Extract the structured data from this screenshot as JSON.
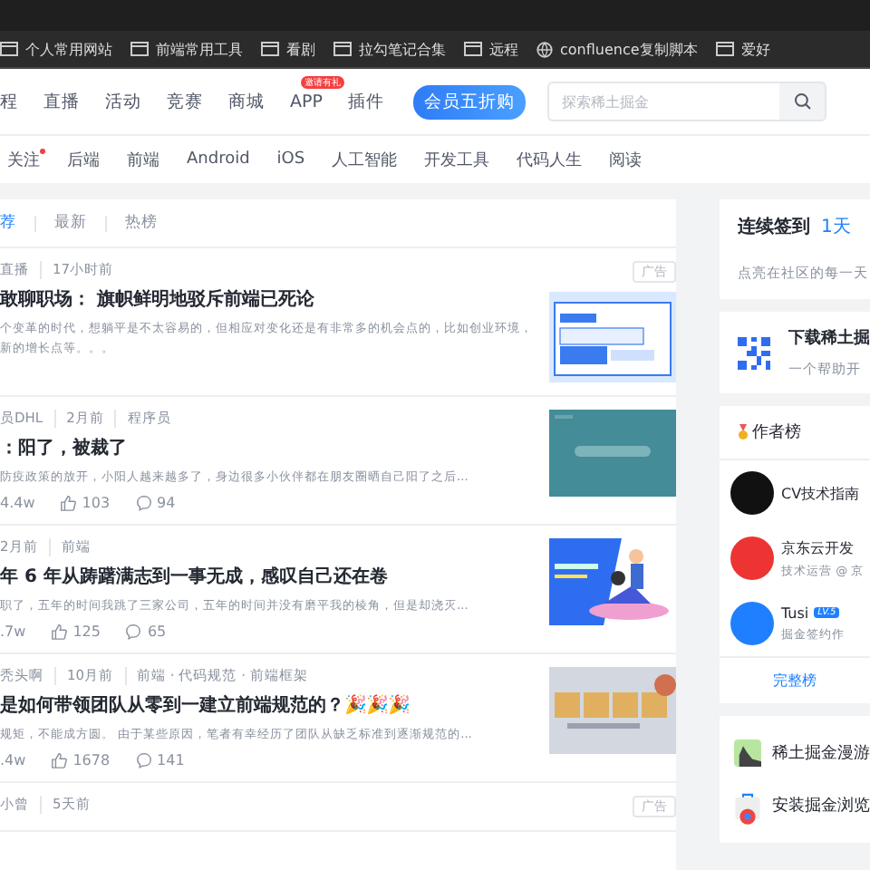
{
  "bookmarks": [
    {
      "label": "个人常用网站",
      "kind": "folder"
    },
    {
      "label": "前端常用工具",
      "kind": "folder"
    },
    {
      "label": "看剧",
      "kind": "folder"
    },
    {
      "label": "拉勾笔记合集",
      "kind": "folder"
    },
    {
      "label": "远程",
      "kind": "folder"
    },
    {
      "label": "confluence复制脚本",
      "kind": "globe"
    },
    {
      "label": "爱好",
      "kind": "folder"
    }
  ],
  "nav": [
    {
      "label": "程"
    },
    {
      "label": "直播"
    },
    {
      "label": "活动"
    },
    {
      "label": "竞赛"
    },
    {
      "label": "商城"
    },
    {
      "label": "APP",
      "badge": "邀请有礼"
    },
    {
      "label": "插件"
    }
  ],
  "promo": "会员五折购",
  "search": {
    "placeholder": "探索稀土掘金"
  },
  "tags": [
    {
      "label": "关注",
      "dot": true
    },
    {
      "label": "后端",
      "dot": false
    },
    {
      "label": "前端",
      "dot": false
    },
    {
      "label": "Android",
      "dot": false
    },
    {
      "label": "iOS",
      "dot": false
    },
    {
      "label": "人工智能",
      "dot": false
    },
    {
      "label": "开发工具",
      "dot": false
    },
    {
      "label": "代码人生",
      "dot": false
    },
    {
      "label": "阅读",
      "dot": false
    }
  ],
  "feed_tabs": [
    {
      "label": "荐",
      "selected": true
    },
    {
      "label": "最新",
      "selected": false
    },
    {
      "label": "热榜",
      "selected": false
    }
  ],
  "articles": [
    {
      "meta": [
        "直播",
        "17小时前"
      ],
      "ad": "广告",
      "title": "敢聊职场： 旗帜鲜明地驳斥前端已死论",
      "excerpt": "个变革的时代，想躺平是不太容易的，但相应对变化还是有非常多的机会点的，比如创业环境，新的增长点等。。。",
      "kind": "picture"
    },
    {
      "meta": [
        "员DHL",
        "2月前",
        "程序员"
      ],
      "title": "：阳了，被裁了",
      "excerpt": "防疫政策的放开，小阳人越来越多了，身边很多小伙伴都在朋友圈晒自己阳了之后...",
      "views": "4.4w",
      "likes": "103",
      "comments": "94",
      "kind": "picture"
    },
    {
      "meta": [
        "2月前",
        "前端"
      ],
      "title": "年 6 年从踌躇满志到一事无成，感叹自己还在卷",
      "excerpt": "职了，五年的时间我跳了三家公司，五年的时间并没有磨平我的棱角，但是却浇灭...",
      "views": ".7w",
      "likes": "125",
      "comments": "65",
      "kind": "picture"
    },
    {
      "meta": [
        "秃头啊",
        "10月前",
        "前端 · 代码规范 · 前端框架"
      ],
      "title": "是如何带领团队从零到一建立前端规范的？🎉🎉🎉",
      "excerpt": "规矩，不能成方圆。 由于某些原因，笔者有幸经历了团队从缺乏标准到逐渐规范的...",
      "views": ".4w",
      "likes": "1678",
      "comments": "141",
      "kind": "picture"
    },
    {
      "meta": [
        "小曾",
        "5天前"
      ],
      "ad": "广告"
    }
  ],
  "checkin": {
    "title": "连续签到",
    "days": "1天",
    "subtitle": "点亮在社区的每一天"
  },
  "download": {
    "title": "下载稀土掘",
    "subtitle": "一个帮助开"
  },
  "authors": {
    "title": "作者榜",
    "items": [
      {
        "name": "CV技术指南"
      },
      {
        "name": "京东云开发",
        "desc": "技术运营 @ 京"
      },
      {
        "name": "Tusi",
        "level": "LV.5",
        "desc": "掘金签约作"
      }
    ],
    "more": "完整榜"
  },
  "extras": [
    {
      "label": "稀土掘金漫游",
      "kind": "picture"
    },
    {
      "label": "安装掘金浏览",
      "kind": "chrome"
    }
  ]
}
